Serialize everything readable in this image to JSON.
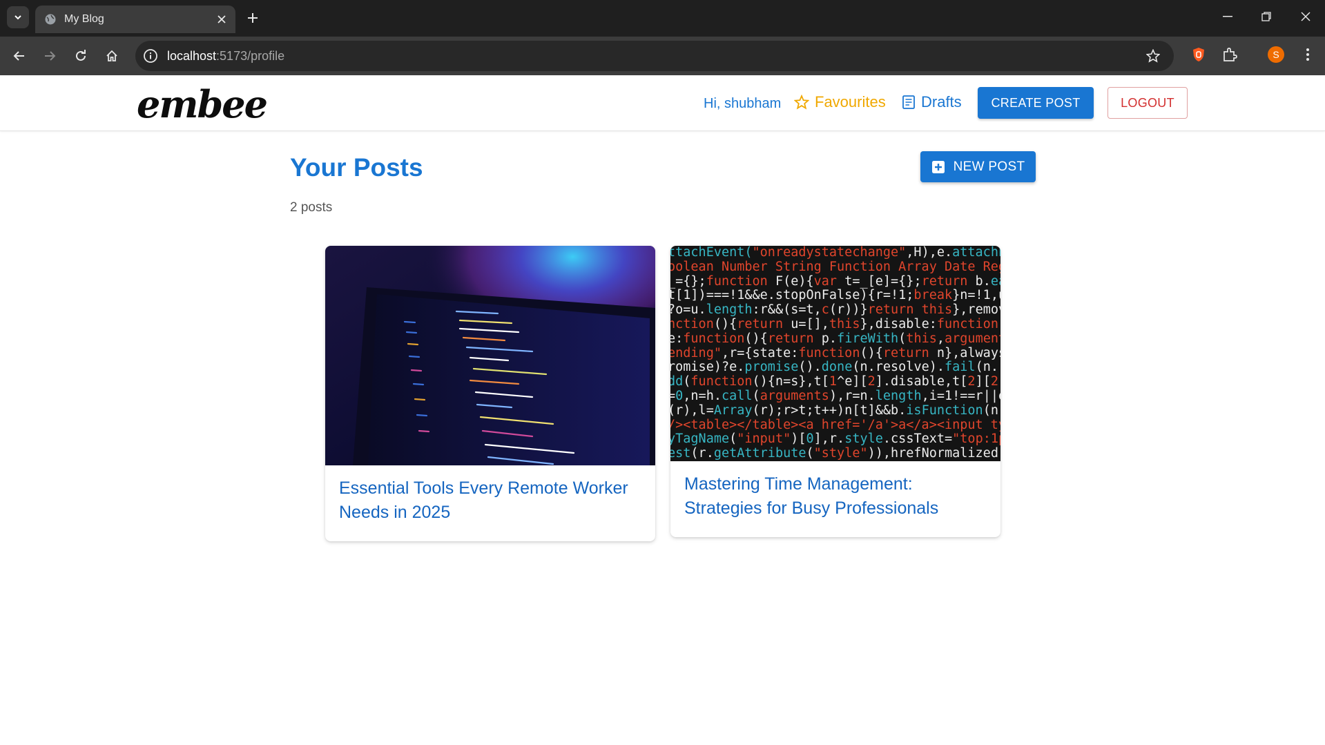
{
  "browser": {
    "tab_title": "My Blog",
    "url_host": "localhost",
    "url_path": ":5173/profile",
    "profile_initial": "S"
  },
  "header": {
    "logo": "embee",
    "greeting": "Hi, shubham",
    "favourites": "Favourites",
    "drafts": "Drafts",
    "create_post": "CREATE POST",
    "logout": "LOGOUT"
  },
  "main": {
    "title": "Your Posts",
    "post_count": "2 posts",
    "new_post": "NEW POST"
  },
  "posts": [
    {
      "title": "Essential Tools Every Remote Worker Needs in 2025",
      "image": "laptop-code-photo"
    },
    {
      "title": "Mastering Time Management: Strategies for Busy Professionals",
      "image": "code-screen-photo"
    }
  ],
  "colors": {
    "primary": "#1976d2",
    "favourite": "#f0a800",
    "logout": "#d32f2f",
    "title_link": "#1565c0"
  }
}
